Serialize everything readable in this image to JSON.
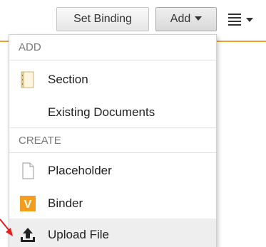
{
  "toolbar": {
    "set_binding_label": "Set Binding",
    "add_label": "Add"
  },
  "dropdown": {
    "add_header": "ADD",
    "create_header": "CREATE",
    "items": [
      {
        "label": "Section",
        "icon": "section-icon"
      },
      {
        "label": "Existing Documents",
        "icon": ""
      },
      {
        "label": "Placeholder",
        "icon": "placeholder-icon"
      },
      {
        "label": "Binder",
        "icon": "binder-icon"
      },
      {
        "label": "Upload File",
        "icon": "upload-icon"
      }
    ],
    "binder_icon_letter": "V",
    "highlight_color": "#eeeeee"
  },
  "colors": {
    "accent_line": "#f0a030",
    "binder_orange": "#f29d1f",
    "pointer_red": "#e02020"
  }
}
